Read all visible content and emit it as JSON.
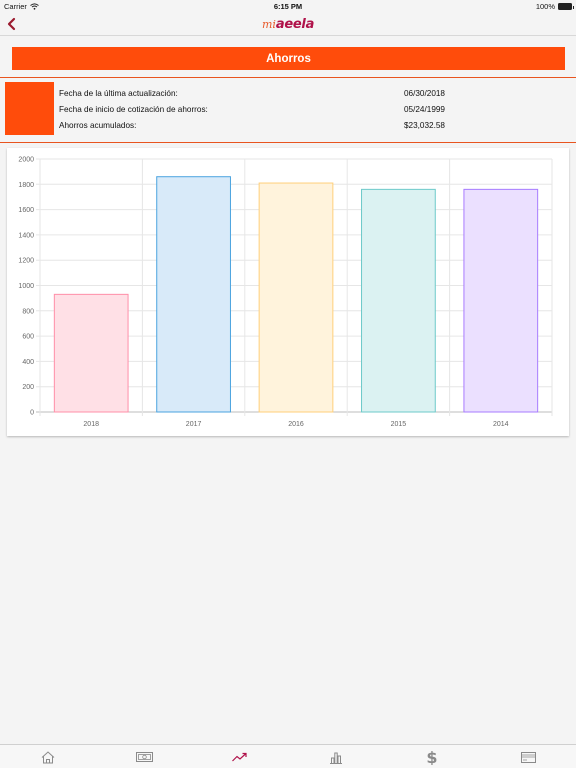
{
  "status_bar": {
    "carrier": "Carrier",
    "time": "6:15 PM",
    "battery": "100%"
  },
  "nav": {
    "logo_prefix": "mi",
    "logo_brand": "aeela"
  },
  "page": {
    "title": "Ahorros"
  },
  "info": {
    "rows": [
      {
        "label": "Fecha de la última actualización:",
        "value": "06/30/2018"
      },
      {
        "label": "Fecha de inicio de cotización de ahorros:",
        "value": "05/24/1999"
      },
      {
        "label": "Ahorros acumulados:",
        "value": "$23,032.58"
      }
    ],
    "accent": "#ff4c0b"
  },
  "chart_data": {
    "type": "bar",
    "categories": [
      "2018",
      "2017",
      "2016",
      "2015",
      "2014"
    ],
    "values": [
      930,
      1860,
      1810,
      1760,
      1760
    ],
    "ylim": [
      0,
      2000
    ],
    "yticks": [
      0,
      200,
      400,
      600,
      800,
      1000,
      1200,
      1400,
      1600,
      1800,
      2000
    ],
    "title": "",
    "xlabel": "",
    "ylabel": "",
    "grid": true,
    "bar_fills": [
      "#ffe0e6",
      "#d8eaf9",
      "#fff3dc",
      "#dbf2f2",
      "#ebe0ff"
    ],
    "bar_strokes": [
      "#ff8fa8",
      "#4aa3df",
      "#ffcf7a",
      "#6cc9c9",
      "#a77bff"
    ]
  },
  "tabs": [
    {
      "name": "home",
      "icon": "home-icon"
    },
    {
      "name": "money",
      "icon": "money-icon"
    },
    {
      "name": "savings",
      "icon": "trend-up-icon",
      "active": true
    },
    {
      "name": "stats",
      "icon": "bar-chart-icon"
    },
    {
      "name": "dollar",
      "icon": "dollar-icon"
    },
    {
      "name": "card",
      "icon": "card-icon"
    }
  ],
  "colors": {
    "brand": "#ff4c0b",
    "logo": "#b0124a",
    "back_arrow": "#9b1a2e",
    "active_tab": "#b0124a"
  }
}
